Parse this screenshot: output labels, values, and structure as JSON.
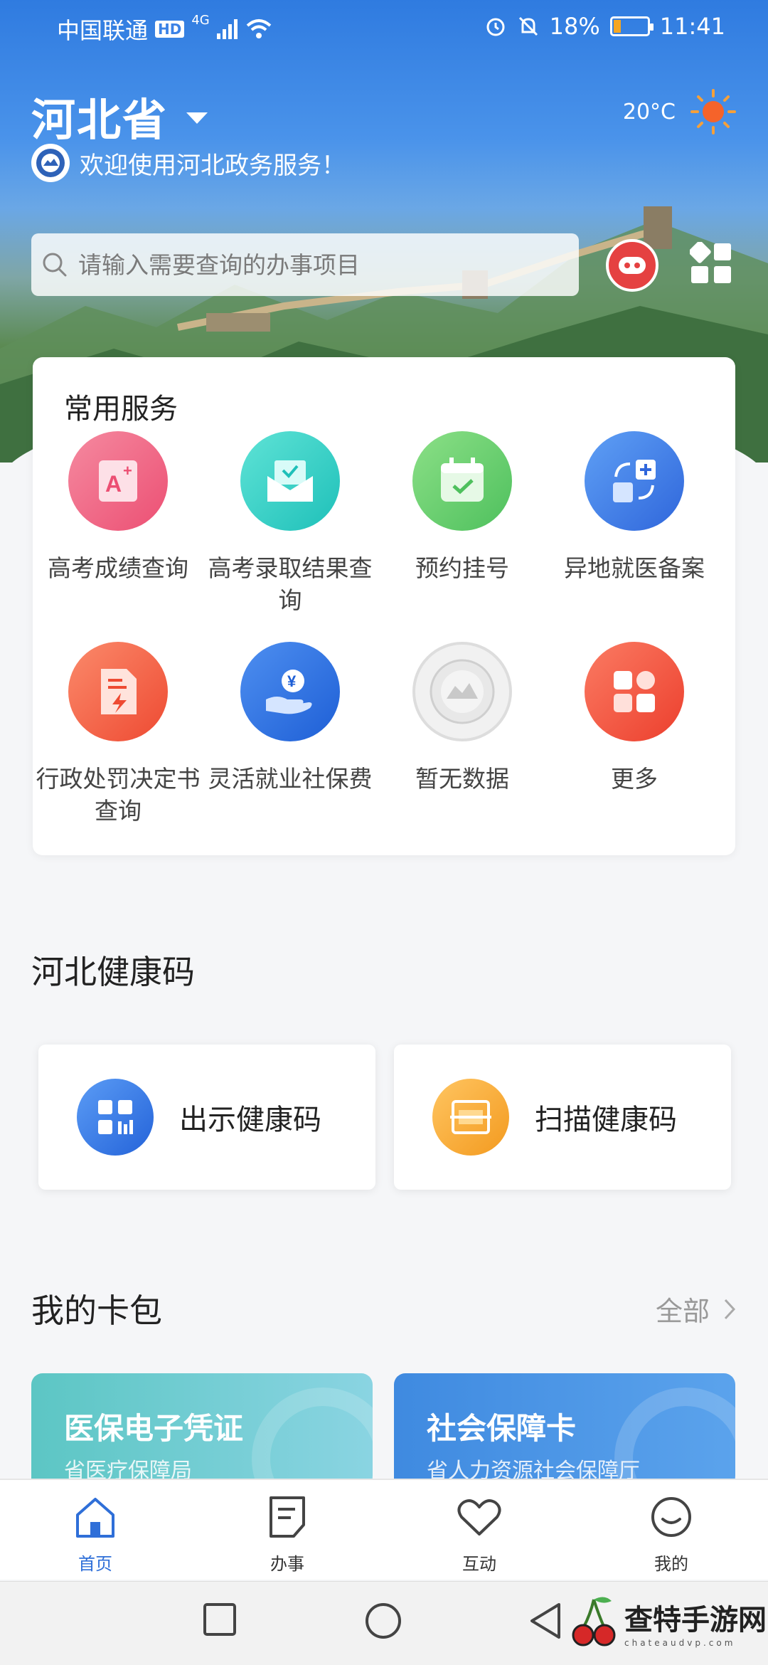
{
  "status_bar": {
    "carrier": "中国联通",
    "hd": "HD",
    "network": "4G",
    "battery": "18%",
    "time": "11:41"
  },
  "header": {
    "province": "河北省",
    "welcome": "欢迎使用河北政务服务！",
    "temperature": "20°C"
  },
  "search": {
    "placeholder": "请输入需要查询的办事项目"
  },
  "common_services": {
    "title": "常用服务",
    "items": [
      {
        "label": "高考成绩查询",
        "icon": "grade-icon",
        "color": "#f05a7e"
      },
      {
        "label": "高考录取结果查询",
        "icon": "admission-mail-icon",
        "color": "#2ccfc6"
      },
      {
        "label": "预约挂号",
        "icon": "calendar-check-icon",
        "color": "#5cc56a"
      },
      {
        "label": "异地就医备案",
        "icon": "medical-transfer-icon",
        "color": "#3a7be8"
      },
      {
        "label": "行政处罚决定书查询",
        "icon": "penalty-document-icon",
        "color": "#f25a3c"
      },
      {
        "label": "灵活就业社保费",
        "icon": "yuan-hand-icon",
        "color": "#2f72e0"
      },
      {
        "label": "暂无数据",
        "icon": "no-data-placeholder-icon",
        "color": "#e8e8e8"
      },
      {
        "label": "更多",
        "icon": "more-grid-icon",
        "color": "#f4503c"
      }
    ]
  },
  "health_code": {
    "title": "河北健康码",
    "show_label": "出示健康码",
    "scan_label": "扫描健康码"
  },
  "wallet": {
    "title": "我的卡包",
    "all_label": "全部",
    "cards": [
      {
        "name": "医保电子凭证",
        "org": "省医疗保障局"
      },
      {
        "name": "社会保障卡",
        "org": "省人力资源社会保障厅"
      }
    ]
  },
  "tabs": [
    {
      "label": "首页",
      "icon": "home-icon"
    },
    {
      "label": "办事",
      "icon": "document-icon"
    },
    {
      "label": "互动",
      "icon": "heart-icon"
    },
    {
      "label": "我的",
      "icon": "profile-smile-icon"
    }
  ],
  "watermark": {
    "text": "查特手游网",
    "sub": "chateaudvp.com"
  },
  "colors": {
    "accent": "#2f6fd8",
    "header_blue": "#2f7be0"
  }
}
